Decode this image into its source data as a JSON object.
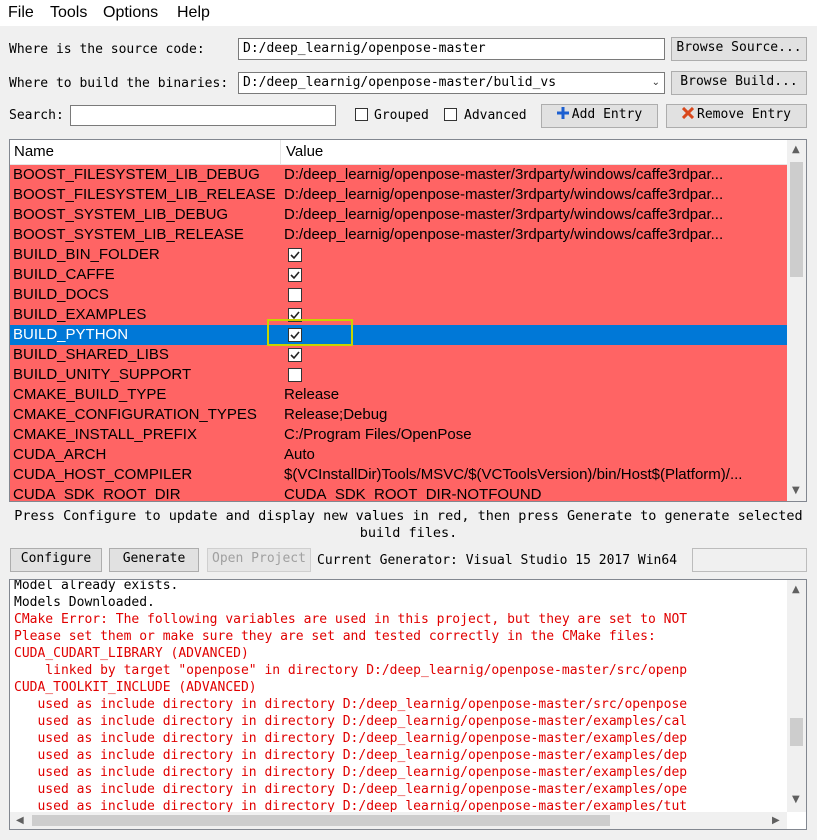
{
  "menu": [
    "File",
    "Tools",
    "Options",
    "Help"
  ],
  "source": {
    "label": "Where is the source code:",
    "value": "D:/deep_learnig/openpose-master",
    "browse": "Browse Source..."
  },
  "build": {
    "label": "Where to build the binaries:",
    "value": "D:/deep_learnig/openpose-master/bulid_vs",
    "browse": "Browse Build..."
  },
  "search": {
    "label": "Search:",
    "value": ""
  },
  "options": {
    "grouped": "Grouped",
    "advanced": "Advanced",
    "add_entry": "Add Entry",
    "remove_entry": "Remove Entry"
  },
  "table": {
    "headers": {
      "name": "Name",
      "value": "Value"
    },
    "rows": [
      {
        "name": "BOOST_FILESYSTEM_LIB_DEBUG",
        "value": "D:/deep_learnig/openpose-master/3rdparty/windows/caffe3rdpar...",
        "type": "text"
      },
      {
        "name": "BOOST_FILESYSTEM_LIB_RELEASE",
        "value": "D:/deep_learnig/openpose-master/3rdparty/windows/caffe3rdpar...",
        "type": "text"
      },
      {
        "name": "BOOST_SYSTEM_LIB_DEBUG",
        "value": "D:/deep_learnig/openpose-master/3rdparty/windows/caffe3rdpar...",
        "type": "text"
      },
      {
        "name": "BOOST_SYSTEM_LIB_RELEASE",
        "value": "D:/deep_learnig/openpose-master/3rdparty/windows/caffe3rdpar...",
        "type": "text"
      },
      {
        "name": "BUILD_BIN_FOLDER",
        "value": "",
        "type": "bool",
        "checked": true
      },
      {
        "name": "BUILD_CAFFE",
        "value": "",
        "type": "bool",
        "checked": true
      },
      {
        "name": "BUILD_DOCS",
        "value": "",
        "type": "bool",
        "checked": false
      },
      {
        "name": "BUILD_EXAMPLES",
        "value": "",
        "type": "bool",
        "checked": true
      },
      {
        "name": "BUILD_PYTHON",
        "value": "",
        "type": "bool",
        "checked": true,
        "selected": true
      },
      {
        "name": "BUILD_SHARED_LIBS",
        "value": "",
        "type": "bool",
        "checked": true
      },
      {
        "name": "BUILD_UNITY_SUPPORT",
        "value": "",
        "type": "bool",
        "checked": false
      },
      {
        "name": "CMAKE_BUILD_TYPE",
        "value": "Release",
        "type": "text"
      },
      {
        "name": "CMAKE_CONFIGURATION_TYPES",
        "value": "Release;Debug",
        "type": "text"
      },
      {
        "name": "CMAKE_INSTALL_PREFIX",
        "value": "C:/Program Files/OpenPose",
        "type": "text"
      },
      {
        "name": "CUDA_ARCH",
        "value": "Auto",
        "type": "text"
      },
      {
        "name": "CUDA_HOST_COMPILER",
        "value": "$(VCInstallDir)Tools/MSVC/$(VCToolsVersion)/bin/Host$(Platform)/...",
        "type": "text"
      },
      {
        "name": "CUDA_SDK_ROOT_DIR",
        "value": "CUDA_SDK_ROOT_DIR-NOTFOUND",
        "type": "text"
      }
    ]
  },
  "hint": "Press Configure to update and display new values in red, then press Generate to generate selected build files.",
  "actions": {
    "configure": "Configure",
    "generate": "Generate",
    "open_project": "Open Project",
    "generator_text": "Current Generator: Visual Studio 15 2017 Win64"
  },
  "output": [
    {
      "text": "Model already exists.",
      "color": "black"
    },
    {
      "text": "Models Downloaded.",
      "color": "black"
    },
    {
      "text": "CMake Error: The following variables are used in this project, but they are set to NOT",
      "color": "red"
    },
    {
      "text": "Please set them or make sure they are set and tested correctly in the CMake files:",
      "color": "red"
    },
    {
      "text": "CUDA_CUDART_LIBRARY (ADVANCED)",
      "color": "red"
    },
    {
      "text": "    linked by target \"openpose\" in directory D:/deep_learnig/openpose-master/src/openp",
      "color": "red"
    },
    {
      "text": "CUDA_TOOLKIT_INCLUDE (ADVANCED)",
      "color": "red"
    },
    {
      "text": "   used as include directory in directory D:/deep_learnig/openpose-master/src/openpose",
      "color": "red"
    },
    {
      "text": "   used as include directory in directory D:/deep_learnig/openpose-master/examples/cal",
      "color": "red"
    },
    {
      "text": "   used as include directory in directory D:/deep_learnig/openpose-master/examples/dep",
      "color": "red"
    },
    {
      "text": "   used as include directory in directory D:/deep_learnig/openpose-master/examples/dep",
      "color": "red"
    },
    {
      "text": "   used as include directory in directory D:/deep_learnig/openpose-master/examples/dep",
      "color": "red"
    },
    {
      "text": "   used as include directory in directory D:/deep_learnig/openpose-master/examples/ope",
      "color": "red"
    },
    {
      "text": "   used as include directory in directory D:/deep_learnig/openpose-master/examples/tut",
      "color": "red"
    }
  ],
  "colors": {
    "changed_row": "#ff6464",
    "selected_row": "#0078d7",
    "error_text": "#e00000",
    "highlight_box": "#c8d400"
  }
}
